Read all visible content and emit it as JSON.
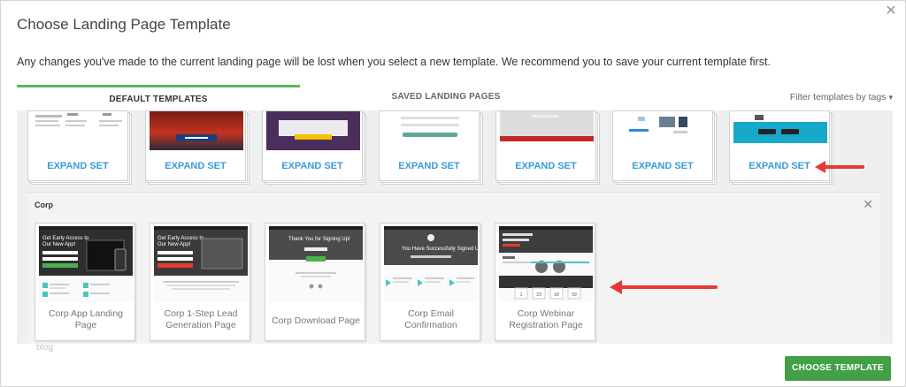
{
  "dialog": {
    "title": "Choose Landing Page Template",
    "notice": "Any changes you've made to the current landing page will be lost when you select a new template. We recommend you to save your current template first."
  },
  "tabs": {
    "default_label": "DEFAULT TEMPLATES",
    "saved_label": "SAVED LANDING PAGES",
    "filter_label": "Filter templates by tags"
  },
  "template_sets": [
    {
      "label": "EXPAND SET"
    },
    {
      "label": "EXPAND SET"
    },
    {
      "label": "EXPAND SET"
    },
    {
      "label": "EXPAND SET"
    },
    {
      "label": "EXPAND SET"
    },
    {
      "label": "EXPAND SET"
    },
    {
      "label": "EXPAND SET"
    }
  ],
  "corp_panel": {
    "title": "Corp",
    "templates": [
      {
        "name": "Corp App Landing Page"
      },
      {
        "name": "Corp 1-Step Lead Generation Page"
      },
      {
        "name": "Corp Download Page"
      },
      {
        "name": "Corp Email Confirmation"
      },
      {
        "name": "Corp Webinar Registration Page"
      }
    ]
  },
  "thumbs": {
    "tpl1_heading": "Get Early Access to Our New App!",
    "tpl3_heading": "Thank You for Signing Up!",
    "tpl4_heading": "You Have Successfully Signed Up!",
    "webinar_numbers": [
      "1",
      "23",
      "18",
      "59"
    ]
  },
  "watermark": "blog",
  "footer": {
    "choose_label": "CHOOSE TEMPLATE"
  },
  "colors": {
    "accent_green": "#5cb85c",
    "button_green": "#43a047",
    "link_blue": "#3a9bd9",
    "arrow_red": "#e53935"
  }
}
